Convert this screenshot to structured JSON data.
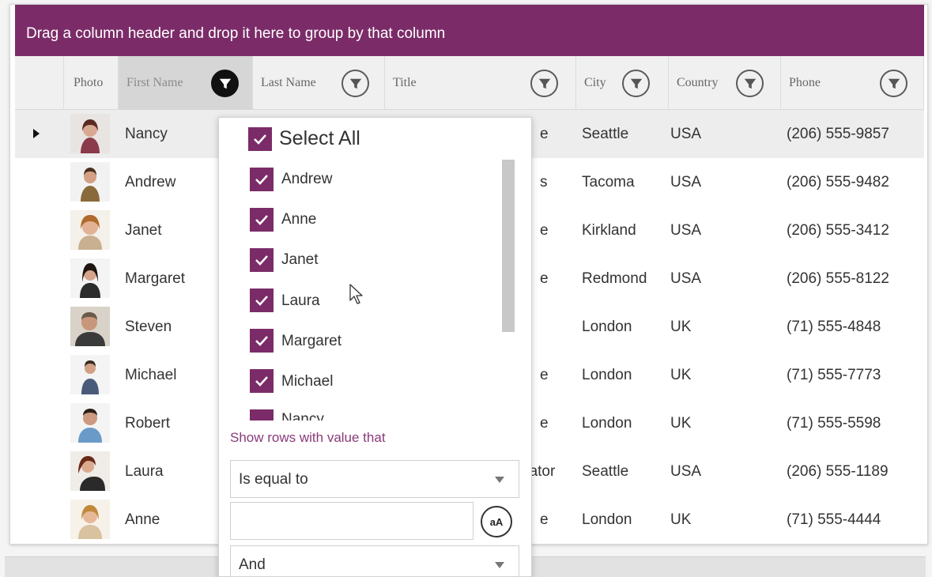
{
  "group_panel": {
    "text": "Drag a column header and drop it here to group by that column"
  },
  "headers": {
    "photo": "Photo",
    "first_name": "First Name",
    "last_name": "Last Name",
    "title": "Title",
    "city": "City",
    "country": "Country",
    "phone": "Phone"
  },
  "rows": [
    {
      "first_name": "Nancy",
      "title_frag": "e",
      "city": "Seattle",
      "country": "USA",
      "phone": "(206) 555-9857"
    },
    {
      "first_name": "Andrew",
      "title_frag": "s",
      "city": "Tacoma",
      "country": "USA",
      "phone": "(206) 555-9482"
    },
    {
      "first_name": "Janet",
      "title_frag": "e",
      "city": "Kirkland",
      "country": "USA",
      "phone": "(206) 555-3412"
    },
    {
      "first_name": "Margaret",
      "title_frag": "e",
      "city": "Redmond",
      "country": "USA",
      "phone": "(206) 555-8122"
    },
    {
      "first_name": "Steven",
      "title_frag": "",
      "city": "London",
      "country": "UK",
      "phone": "(71) 555-4848"
    },
    {
      "first_name": "Michael",
      "title_frag": "e",
      "city": "London",
      "country": "UK",
      "phone": "(71) 555-7773"
    },
    {
      "first_name": "Robert",
      "title_frag": "e",
      "city": "London",
      "country": "UK",
      "phone": "(71) 555-5598"
    },
    {
      "first_name": "Laura",
      "title_frag": "nator",
      "city": "Seattle",
      "country": "USA",
      "phone": "(206) 555-1189"
    },
    {
      "first_name": "Anne",
      "title_frag": "e",
      "city": "London",
      "country": "UK",
      "phone": "(71) 555-4444"
    }
  ],
  "filter_popup": {
    "select_all": "Select All",
    "items": [
      "Andrew",
      "Anne",
      "Janet",
      "Laura",
      "Margaret",
      "Michael",
      "Nancy"
    ],
    "show_rows_label": "Show rows with value that",
    "operator1": "Is equal to",
    "value1": "",
    "case_button": "aA",
    "logical_operator": "And"
  },
  "colors": {
    "accent": "#7b2c68",
    "header_bg": "#f0f0f0",
    "current_row_bg": "#ededed"
  }
}
